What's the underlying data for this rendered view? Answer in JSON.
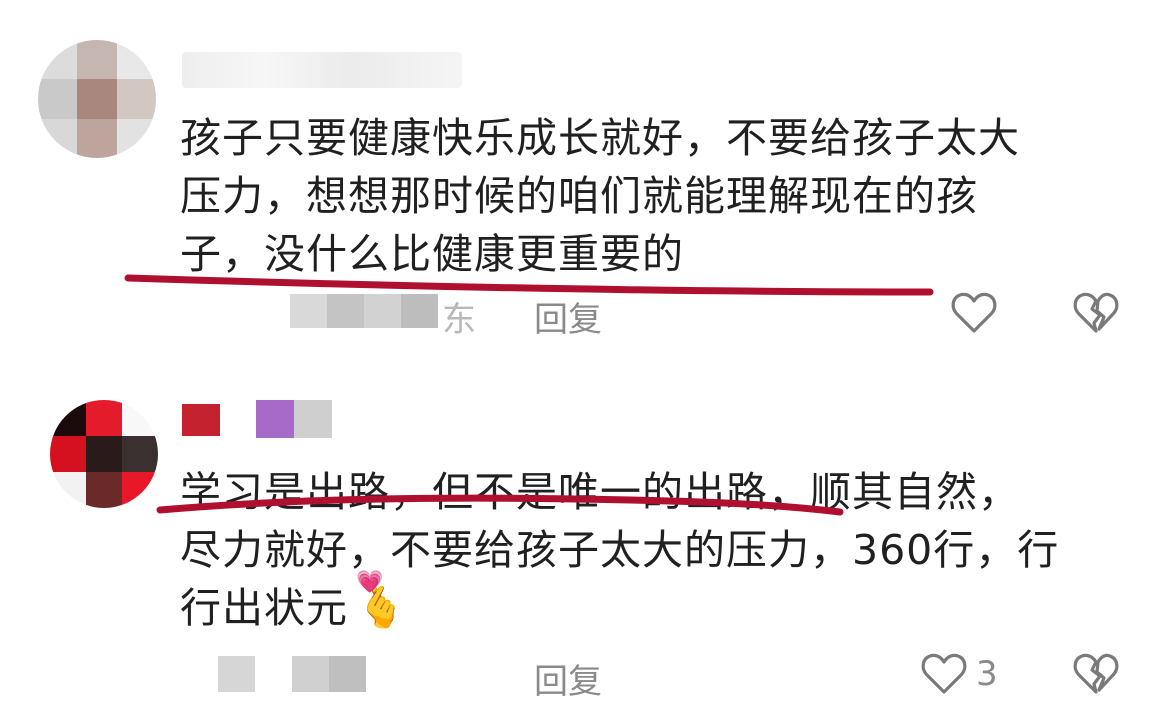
{
  "comments": [
    {
      "username_fragment": "",
      "text_lines": [
        "孩子只要健康快乐成长就好，不要给孩子太大",
        "压力，想想那时候的咱们就能理解现在的孩",
        "子，没什么比健康更重要的"
      ],
      "location_fragment": "东",
      "reply_label": "回复",
      "like_count": "",
      "like_icon": "heart-outline-icon",
      "dislike_icon": "broken-heart-icon",
      "highlight_color": "#b01030"
    },
    {
      "text_lines": [
        "学习是出路，但不是唯一的出路，顺其自然，",
        "尽力就好，不要给孩子太大的压力，360行，行",
        "行出状元"
      ],
      "emoji": "🫰",
      "emoji_heart": "💗",
      "reply_label": "回复",
      "like_count": "3",
      "like_icon": "heart-outline-icon",
      "dislike_icon": "broken-heart-icon",
      "highlight_color": "#b01030"
    }
  ],
  "colors": {
    "text": "#202020",
    "muted": "#8a8a8a",
    "underline": "#b01030"
  }
}
